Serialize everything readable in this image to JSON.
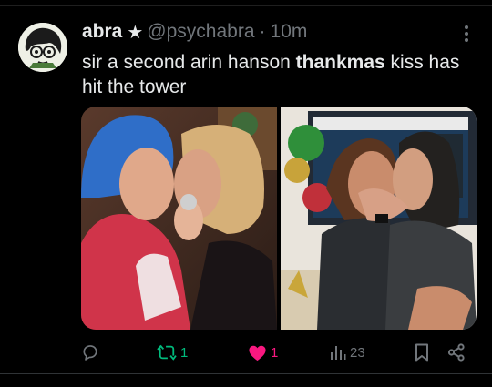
{
  "post": {
    "author_name": "abra",
    "author_handle": "@psychabra",
    "separator": "·",
    "time": "10m",
    "text_part1": "sir a second arin hanson ",
    "text_bold": "thankmas",
    "text_part2": " kiss has hit the tower",
    "photos": [
      {
        "icon": "photo-left"
      },
      {
        "icon": "photo-right"
      }
    ]
  },
  "actions": {
    "reply_count": "",
    "retweet_count": "1",
    "like_count": "1",
    "views_count": "23",
    "retweet_color": "#00ba7c",
    "like_color": "#f91880",
    "muted_color": "#71767b"
  }
}
